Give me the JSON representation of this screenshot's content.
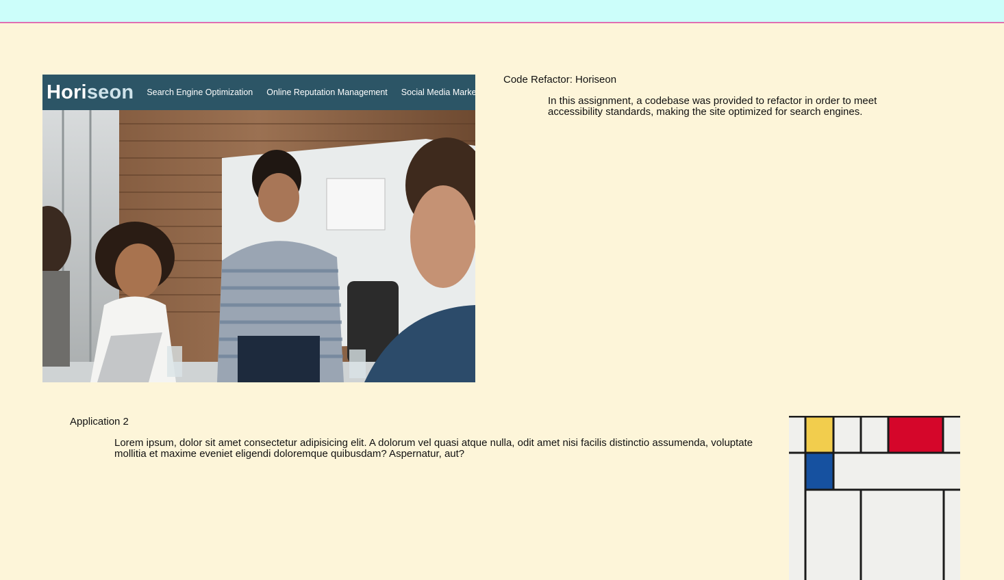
{
  "projects": [
    {
      "title": "Code Refactor: Horiseon",
      "description": "In this assignment, a codebase was provided to refactor in order to meet accessibility standards, making the site optimized for search engines.",
      "thumbnail": {
        "logo_part1": "Hori",
        "logo_part2": "seon",
        "nav": [
          "Search Engine Optimization",
          "Online Reputation Management",
          "Social Media Marketing"
        ]
      }
    },
    {
      "title": "Application 2",
      "description": "Lorem ipsum, dolor sit amet consectetur adipisicing elit. A dolorum vel quasi atque nulla, odit amet nisi facilis distinctio assumenda, voluptate mollitia et maxime eveniet eligendi doloremque quibusdam? Aspernatur, aut?"
    }
  ],
  "colors": {
    "page_background": "#fdf5d9",
    "topbar": "#ccfefa",
    "topbar_border": "#e06fb0",
    "horiseon_header": "#2c5566",
    "mondrian_yellow": "#f2cd4d",
    "mondrian_red": "#d5062a",
    "mondrian_blue": "#1651a0"
  }
}
